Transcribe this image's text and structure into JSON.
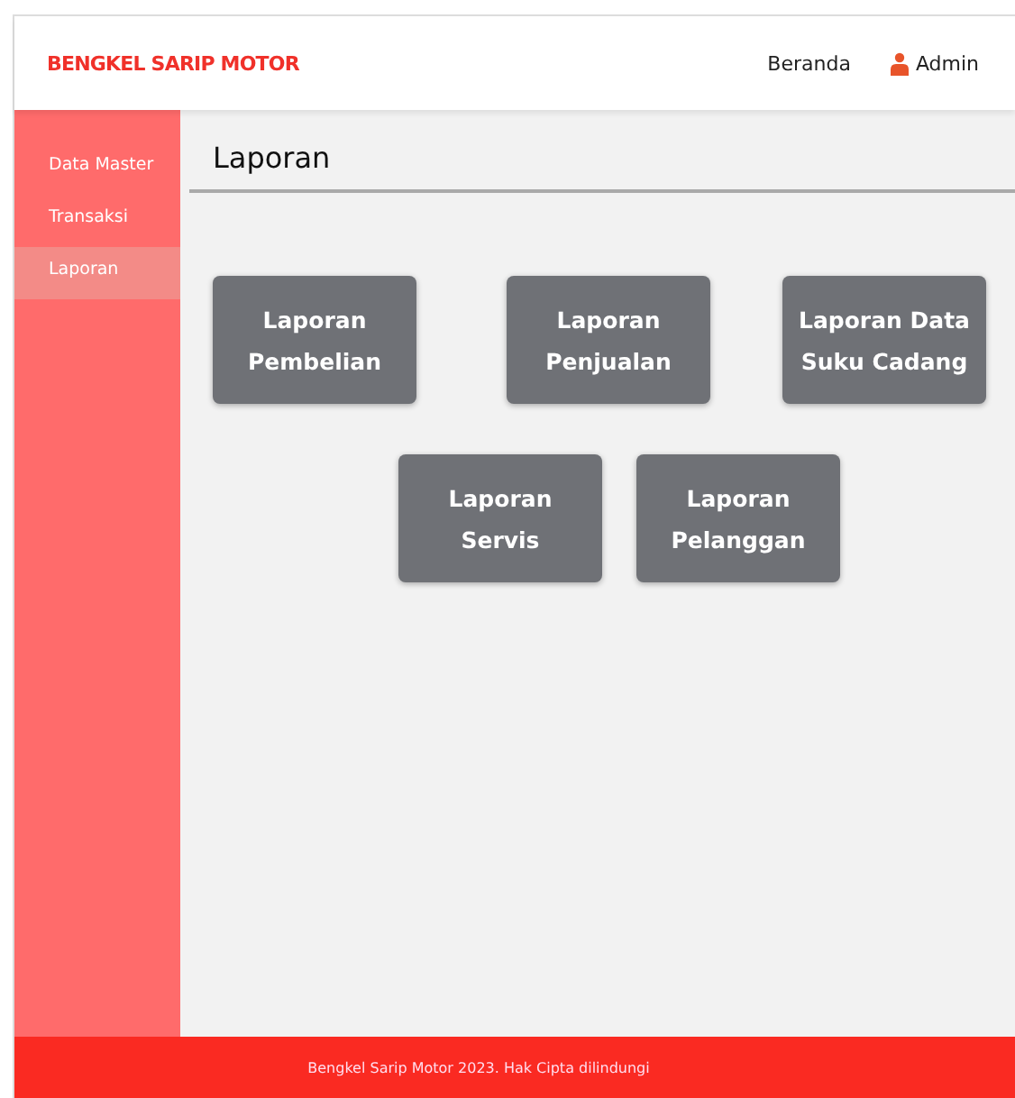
{
  "header": {
    "brand": "BENGKEL SARIP MOTOR",
    "nav": [
      {
        "label": "Beranda"
      },
      {
        "label": "Admin"
      }
    ]
  },
  "sidebar": {
    "items": [
      {
        "label": "Data Master",
        "selected": false
      },
      {
        "label": "Transaksi",
        "selected": false
      },
      {
        "label": "Laporan",
        "selected": true
      }
    ]
  },
  "page_title": "Laporan",
  "report_buttons": [
    [
      "Laporan",
      "Pembelian"
    ],
    [
      "Laporan",
      "Penjualan"
    ],
    [
      "Laporan Data",
      "Suku Cadang"
    ],
    [
      "Laporan",
      "Servis"
    ],
    [
      "Laporan",
      "Pelanggan"
    ]
  ],
  "footer": "Bengkel Sarip Motor 2023. Hak Cipta dilindungi"
}
